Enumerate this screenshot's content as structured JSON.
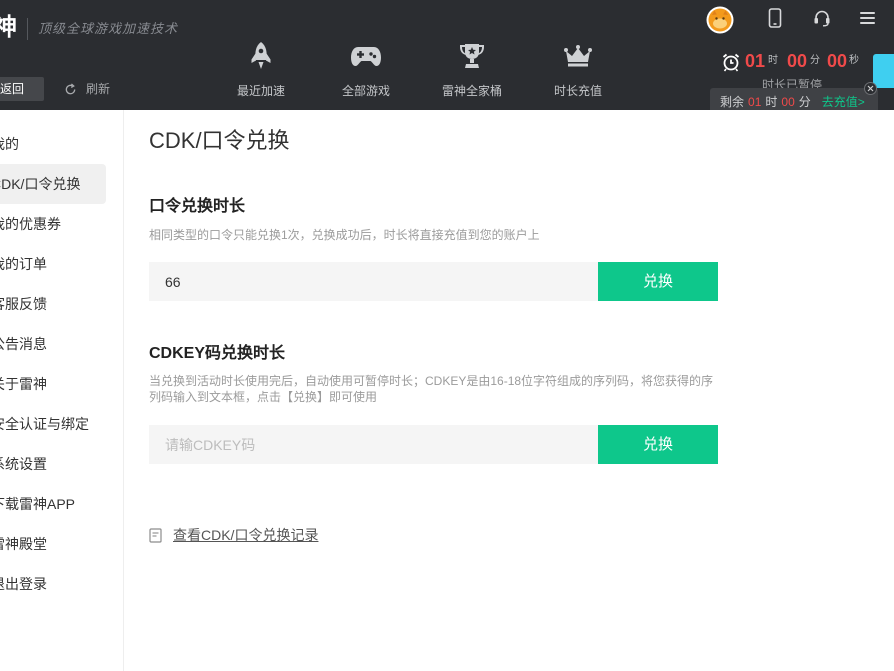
{
  "brand": {
    "logo_text": "雷神",
    "tagline": "顶级全球游戏加速技术"
  },
  "toolbar": {
    "back_label": "返回",
    "refresh_label": "刷新",
    "refresh_icon": "refresh-icon"
  },
  "header_icons": [
    "avatar",
    "phone-icon",
    "headset-icon",
    "menu-icon"
  ],
  "nav": [
    {
      "label": "最近加速",
      "icon": "rocket-icon"
    },
    {
      "label": "全部游戏",
      "icon": "gamepad-icon"
    },
    {
      "label": "雷神全家桶",
      "icon": "trophy-icon"
    },
    {
      "label": "时长充值",
      "icon": "crown-icon"
    }
  ],
  "timer": {
    "icon": "alarm-clock-icon",
    "hours": "01",
    "hours_unit": "时",
    "minutes": "00",
    "minutes_unit": "分",
    "seconds": "00",
    "seconds_unit": "秒",
    "status": "时长已暂停"
  },
  "tooltip": {
    "prefix": "剩余",
    "hours": "01",
    "hours_unit": "时",
    "minutes": "00",
    "minutes_unit": "分",
    "action": "去充值>",
    "close_icon": "close-icon"
  },
  "sidebar": {
    "active_index": 1,
    "items": [
      "我的",
      "CDK/口令兑换",
      "我的优惠券",
      "我的订单",
      "客服反馈",
      "公告消息",
      "关于雷神",
      "安全认证与绑定",
      "系统设置",
      "下载雷神APP",
      "雷神殿堂",
      "退出登录"
    ]
  },
  "main": {
    "title": "CDK/口令兑换",
    "code_section": {
      "heading": "口令兑换时长",
      "description": "相同类型的口令只能兑换1次，兑换成功后，时长将直接充值到您的账户上",
      "input_value": "66",
      "button_label": "兑换"
    },
    "cdkey_section": {
      "heading": "CDKEY码兑换时长",
      "description_lines": [
        "当兑换到活动时长使用完后，自动使用可暂停时长；CDKEY是由16-18位字符组成的序列码，将您获得的序",
        "列码输入到文本框，点击【兑换】即可使用"
      ],
      "input_placeholder": "请输CDKEY码",
      "button_label": "兑换"
    },
    "history_icon": "document-icon",
    "history_link": "查看CDK/口令兑换记录"
  },
  "colors": {
    "header_bg": "#2b2d31",
    "accent": "#0ec78b",
    "timer_red": "#f04a4a",
    "cyan": "#3fcff0"
  }
}
